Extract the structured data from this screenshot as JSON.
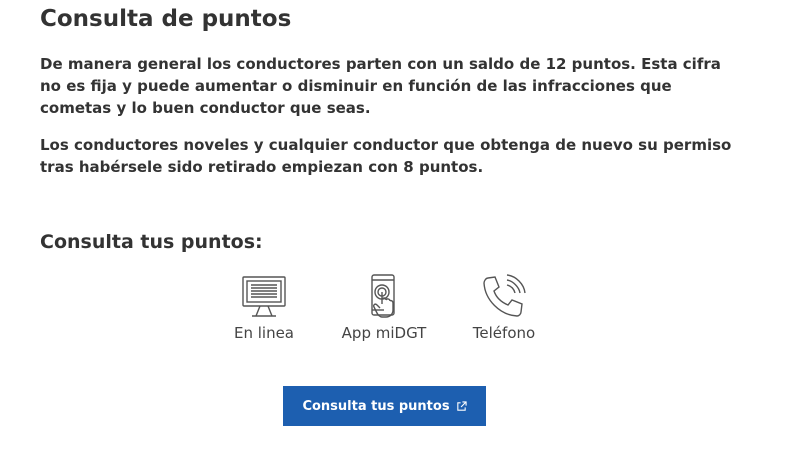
{
  "page": {
    "title": "Consulta de puntos",
    "paragraph_1": "De manera general los conductores parten con un saldo de 12 puntos. Esta cifra no es fija y puede aumentar o disminuir en función de las infracciones que cometas y lo buen conductor que seas.",
    "paragraph_2": "Los conductores noveles y cualquier conductor que obtenga de nuevo su permiso tras habérsele sido retirado empiezan con 8 puntos.",
    "subtitle": "Consulta tus puntos:"
  },
  "options": [
    {
      "label": "En linea",
      "icon": "computer-monitor-icon"
    },
    {
      "label": "App miDGT",
      "icon": "smartphone-tap-icon"
    },
    {
      "label": "Teléfono",
      "icon": "phone-ringing-icon"
    }
  ],
  "cta": {
    "label": "Consulta tus puntos",
    "icon": "external-link-icon"
  },
  "colors": {
    "text": "#333333",
    "button_bg": "#1d5fb0",
    "button_text": "#ffffff",
    "icon_stroke": "#555555"
  }
}
